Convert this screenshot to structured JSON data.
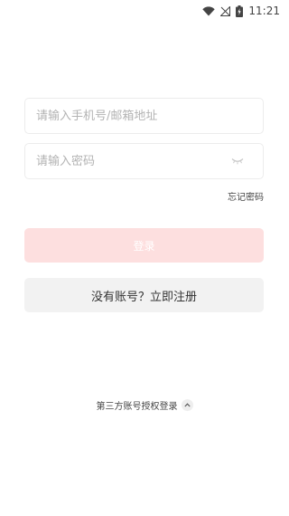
{
  "status_bar": {
    "time": "11:21",
    "icons": [
      "wifi-icon",
      "no-signal-icon",
      "battery-charging-icon"
    ]
  },
  "login_form": {
    "account_placeholder": "请输入手机号/邮箱地址",
    "password_placeholder": "请输入密码",
    "password_toggle_icon": "eye-closed-icon",
    "forgot_password_label": "忘记密码",
    "login_button_label": "登录",
    "register_button_label": "没有账号？立即注册"
  },
  "third_party": {
    "label": "第三方账号授权登录",
    "toggle_icon": "chevron-up-icon"
  },
  "colors": {
    "login_button_bg": "#fddfdf",
    "register_button_bg": "#f2f2f2",
    "input_border": "#ececec",
    "placeholder": "#b3b3b3"
  }
}
